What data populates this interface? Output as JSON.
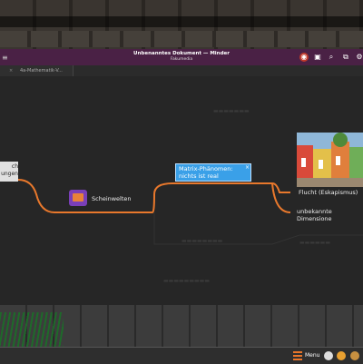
{
  "window": {
    "title": "Unbenanntes Dokument — Minder",
    "subtitle": "Fakumedia"
  },
  "tabs": [
    {
      "label": "4a-Mathematik-V..."
    }
  ],
  "mindmap": {
    "left_node_text": "ch\nungen",
    "scheinwelten": "Scheinwelten",
    "selected_node": "Matrix-Phänomen: nichts ist real",
    "branch_flucht": "Flucht (Eskapismus)",
    "branch_unbekannte": "unbekannte Dimensione"
  },
  "taskbar": {
    "menu_label": "Menu"
  },
  "colors": {
    "titlebar": "#4a2145",
    "connector": "#e8782c",
    "selection": "#3aa0e8"
  }
}
